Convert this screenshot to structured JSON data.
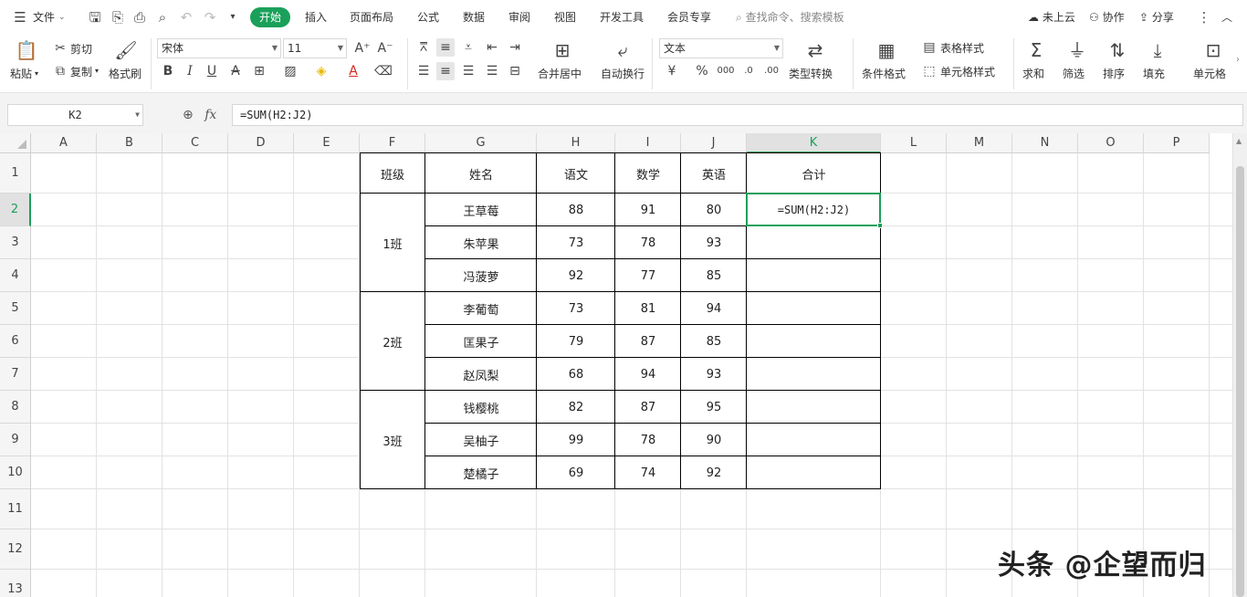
{
  "menubar": {
    "file": "文件",
    "tabs": [
      "开始",
      "插入",
      "页面布局",
      "公式",
      "数据",
      "审阅",
      "视图",
      "开发工具",
      "会员专享"
    ],
    "active_tab": "开始",
    "search_placeholder": "查找命令、搜索模板",
    "cloud": "未上云",
    "collab": "协作",
    "share": "分享"
  },
  "ribbon": {
    "paste": "粘贴",
    "cut": "剪切",
    "copy": "复制",
    "format_painter": "格式刷",
    "font_name": "宋体",
    "font_size": "11",
    "merge_center": "合并居中",
    "wrap_text": "自动换行",
    "number_format": "文本",
    "type_convert": "类型转换",
    "cond_format": "条件格式",
    "table_style": "表格样式",
    "cell_style": "单元格样式",
    "sum": "求和",
    "filter": "筛选",
    "sort": "排序",
    "fill": "填充",
    "cell": "单元格"
  },
  "formula_bar": {
    "name_box": "K2",
    "fx": "fx",
    "formula": "=SUM(H2:J2)"
  },
  "sheet": {
    "columns": [
      "A",
      "B",
      "C",
      "D",
      "E",
      "F",
      "G",
      "H",
      "I",
      "J",
      "K",
      "L",
      "M",
      "N",
      "O",
      "P"
    ],
    "rows": [
      "1",
      "2",
      "3",
      "4",
      "5",
      "6",
      "7",
      "8",
      "9",
      "10",
      "11",
      "12",
      "13"
    ],
    "active_column": "K",
    "active_row": "2",
    "headers": {
      "class": "班级",
      "name": "姓名",
      "chinese": "语文",
      "math": "数学",
      "english": "英语",
      "total": "合计"
    },
    "classes": [
      "1班",
      "2班",
      "3班"
    ],
    "students": [
      {
        "name": "王草莓",
        "chinese": "88",
        "math": "91",
        "english": "80"
      },
      {
        "name": "朱苹果",
        "chinese": "73",
        "math": "78",
        "english": "93"
      },
      {
        "name": "冯菠萝",
        "chinese": "92",
        "math": "77",
        "english": "85"
      },
      {
        "name": "李葡萄",
        "chinese": "73",
        "math": "81",
        "english": "94"
      },
      {
        "name": "匡果子",
        "chinese": "79",
        "math": "87",
        "english": "85"
      },
      {
        "name": "赵凤梨",
        "chinese": "68",
        "math": "94",
        "english": "93"
      },
      {
        "name": "钱樱桃",
        "chinese": "82",
        "math": "87",
        "english": "95"
      },
      {
        "name": "吴柚子",
        "chinese": "99",
        "math": "78",
        "english": "90"
      },
      {
        "name": "楚橘子",
        "chinese": "69",
        "math": "74",
        "english": "92"
      }
    ],
    "editing_cell_value": "=SUM(H2:J2)"
  },
  "watermark": "头条 @企望而归",
  "colors": {
    "accent": "#1aa05a",
    "header_bg": "#f5f5f5",
    "grid": "#e2e2e2"
  }
}
